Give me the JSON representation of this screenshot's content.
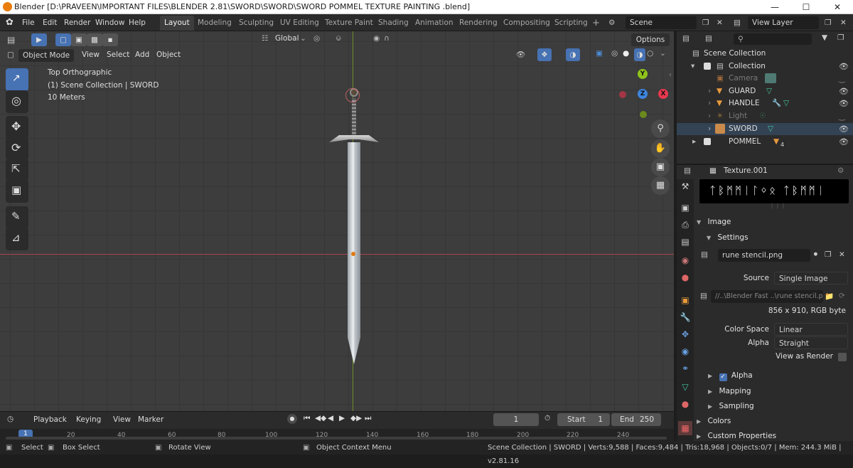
{
  "window": {
    "title": "Blender [D:\\PRAVEEN\\IMPORTANT FILES\\BLENDER 2.81\\SWORD\\SWORD\\SWORD POMMEL TEXTURE PAINTING .blend]",
    "minimize_icon": "minimize-icon",
    "maximize_icon": "maximize-icon",
    "close_icon": "close-icon"
  },
  "menu": [
    "File",
    "Edit",
    "Render",
    "Window",
    "Help"
  ],
  "workspaces": [
    {
      "label": "Layout",
      "active": true
    },
    {
      "label": "Modeling"
    },
    {
      "label": "Sculpting"
    },
    {
      "label": "UV Editing"
    },
    {
      "label": "Texture Paint"
    },
    {
      "label": "Shading"
    },
    {
      "label": "Animation"
    },
    {
      "label": "Rendering"
    },
    {
      "label": "Compositing"
    },
    {
      "label": "Scripting"
    }
  ],
  "add_workspace": "+",
  "scene": {
    "value": "Scene"
  },
  "view_layer": {
    "value": "View Layer"
  },
  "viewport_header": {
    "mode": "Object Mode",
    "menus": [
      "View",
      "Select",
      "Add",
      "Object"
    ],
    "orientation": "Global",
    "options": "Options"
  },
  "viewport": {
    "view_name": "Top Orthographic",
    "collection_info": "(1) Scene Collection | SWORD",
    "scale": "10 Meters",
    "gizmo": {
      "x": "X",
      "y": "Y",
      "z": "Z",
      "x_color": "#e8384f",
      "y_color": "#8fc41b",
      "z_color": "#3c85dd"
    }
  },
  "outliner": {
    "search_placeholder": "",
    "rows": [
      {
        "label": "Scene Collection",
        "indent": 0
      },
      {
        "label": "Collection",
        "indent": 1
      },
      {
        "label": "Camera",
        "indent": 2,
        "dim": true
      },
      {
        "label": "GUARD",
        "indent": 2
      },
      {
        "label": "HANDLE",
        "indent": 2
      },
      {
        "label": "Light",
        "indent": 2,
        "dim": true
      },
      {
        "label": "SWORD",
        "indent": 2
      },
      {
        "label": "POMMEL",
        "indent": 1,
        "badge": "4"
      }
    ]
  },
  "properties": {
    "texture_name": "Texture.001",
    "preview_runes": "ᛏᛒᛗᛗᛁᛚᛜᛟ  ᛏᛒᛗᛗᛁ",
    "image_section": "Image",
    "settings_section": "Settings",
    "image_file": "rune stencil.png",
    "source_label": "Source",
    "source_value": "Single Image",
    "filepath": "//..\\Blender Fast ..\\rune stencil.png",
    "resolution": "856 x 910,  RGB byte",
    "color_space_label": "Color Space",
    "color_space_value": "Linear",
    "alpha_label": "Alpha",
    "alpha_value": "Straight",
    "view_as_render": "View as Render",
    "alpha_check": "Alpha",
    "mapping": "Mapping",
    "sampling": "Sampling",
    "colors": "Colors",
    "custom_properties": "Custom Properties"
  },
  "timeline": {
    "menus": [
      "Playback",
      "Keying",
      "View",
      "Marker"
    ],
    "current_frame": "1",
    "start_label": "Start",
    "start_value": "1",
    "end_label": "End",
    "end_value": "250",
    "ticks": [
      "1",
      "20",
      "40",
      "60",
      "80",
      "100",
      "120",
      "140",
      "160",
      "180",
      "200",
      "220",
      "240"
    ]
  },
  "statusbar": {
    "select": "Select",
    "box_select": "Box Select",
    "rotate_view": "Rotate View",
    "context_menu": "Object Context Menu",
    "stats": "Scene Collection | SWORD | Verts:9,588 | Faces:9,484 | Tris:18,968 | Objects:0/7 | Mem: 244.3 MiB | v2.81.16"
  }
}
